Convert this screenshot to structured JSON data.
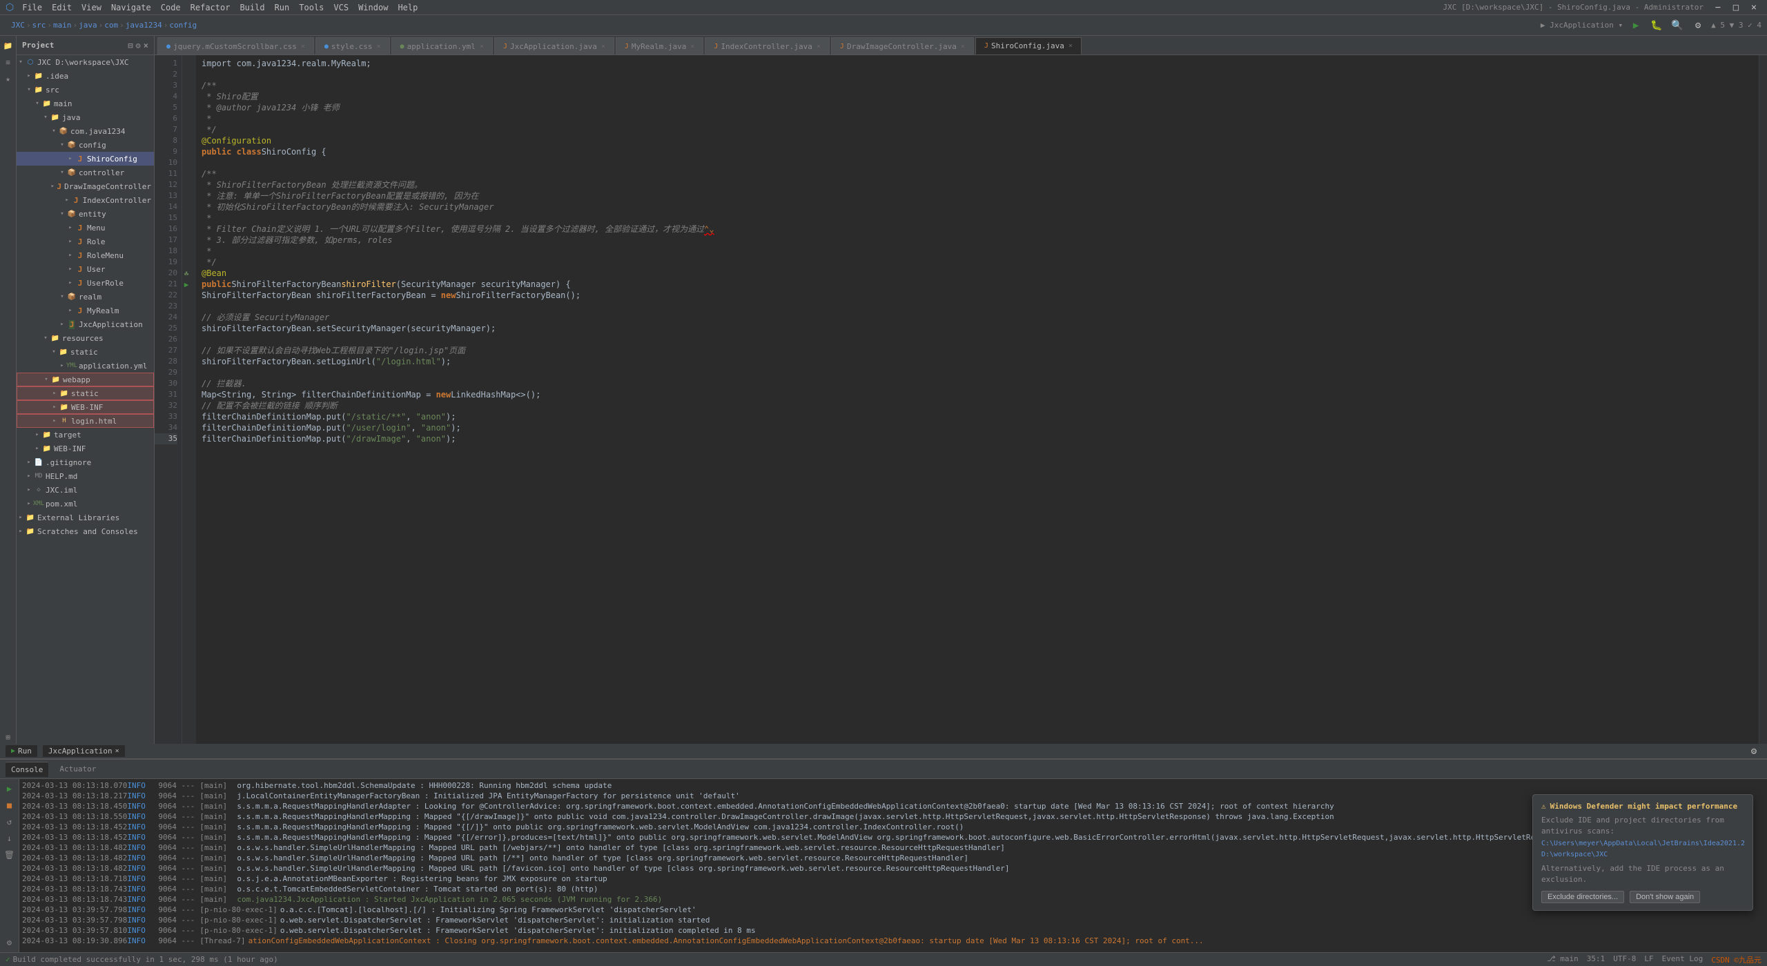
{
  "app": {
    "title": "JXC [D:\\workspace\\JXC] - ShiroConfig.java - Administrator",
    "window_title": "JXC [D:\\workspace\\JXC] - ShiroConfig.java - Administrator"
  },
  "menu": {
    "items": [
      "File",
      "Edit",
      "View",
      "Navigate",
      "Code",
      "Refactor",
      "Build",
      "Run",
      "Tools",
      "VCS",
      "Window",
      "Help"
    ]
  },
  "breadcrumb": {
    "items": [
      "JXC",
      "src",
      "main",
      "java",
      "com",
      "java1234",
      "config"
    ]
  },
  "tabs": [
    {
      "label": "jquery.mCustomScrollbar.css",
      "active": false
    },
    {
      "label": "style.css",
      "active": false
    },
    {
      "label": "application.yml",
      "active": false
    },
    {
      "label": "JxcApplication.java",
      "active": false
    },
    {
      "label": "MyRealm.java",
      "active": false
    },
    {
      "label": "IndexController.java",
      "active": false
    },
    {
      "label": "DrawImageController.java",
      "active": false
    },
    {
      "label": "ShiroConfig.java",
      "active": true
    }
  ],
  "project": {
    "header": "Project",
    "tree": [
      {
        "id": "jxc-root",
        "label": "JXC D:\\workspace\\JXC",
        "indent": 0,
        "icon": "project",
        "expanded": true,
        "selected": false
      },
      {
        "id": "idea",
        "label": ".idea",
        "indent": 1,
        "icon": "folder",
        "expanded": false,
        "selected": false
      },
      {
        "id": "src",
        "label": "src",
        "indent": 1,
        "icon": "folder",
        "expanded": true,
        "selected": false
      },
      {
        "id": "main",
        "label": "main",
        "indent": 2,
        "icon": "folder",
        "expanded": true,
        "selected": false
      },
      {
        "id": "java",
        "label": "java",
        "indent": 3,
        "icon": "folder-blue",
        "expanded": true,
        "selected": false
      },
      {
        "id": "com-java1234",
        "label": "com.java1234",
        "indent": 4,
        "icon": "package",
        "expanded": true,
        "selected": false
      },
      {
        "id": "config",
        "label": "config",
        "indent": 5,
        "icon": "package",
        "expanded": true,
        "selected": false
      },
      {
        "id": "shiroconfig",
        "label": "ShiroConfig",
        "indent": 6,
        "icon": "java",
        "expanded": false,
        "selected": true
      },
      {
        "id": "controller",
        "label": "controller",
        "indent": 5,
        "icon": "package",
        "expanded": true,
        "selected": false
      },
      {
        "id": "drawimagecontroller",
        "label": "DrawImageController",
        "indent": 6,
        "icon": "java",
        "expanded": false,
        "selected": false
      },
      {
        "id": "indexcontroller",
        "label": "IndexController",
        "indent": 6,
        "icon": "java",
        "expanded": false,
        "selected": false
      },
      {
        "id": "entity",
        "label": "entity",
        "indent": 5,
        "icon": "package",
        "expanded": true,
        "selected": false
      },
      {
        "id": "menu",
        "label": "Menu",
        "indent": 6,
        "icon": "java",
        "expanded": false,
        "selected": false
      },
      {
        "id": "role",
        "label": "Role",
        "indent": 6,
        "icon": "java",
        "expanded": false,
        "selected": false
      },
      {
        "id": "rolemenu",
        "label": "RoleMenu",
        "indent": 6,
        "icon": "java",
        "expanded": false,
        "selected": false
      },
      {
        "id": "user",
        "label": "User",
        "indent": 6,
        "icon": "java",
        "expanded": false,
        "selected": false
      },
      {
        "id": "userrole",
        "label": "UserRole",
        "indent": 6,
        "icon": "java",
        "expanded": false,
        "selected": false
      },
      {
        "id": "realm",
        "label": "realm",
        "indent": 5,
        "icon": "package",
        "expanded": true,
        "selected": false
      },
      {
        "id": "myrealm",
        "label": "MyRealm",
        "indent": 6,
        "icon": "java",
        "expanded": false,
        "selected": false
      },
      {
        "id": "jxcapplication",
        "label": "JxcApplication",
        "indent": 5,
        "icon": "java-main",
        "expanded": false,
        "selected": false
      },
      {
        "id": "resources",
        "label": "resources",
        "indent": 3,
        "icon": "folder",
        "expanded": true,
        "selected": false
      },
      {
        "id": "static",
        "label": "static",
        "indent": 4,
        "icon": "folder",
        "expanded": true,
        "selected": false
      },
      {
        "id": "application-yml",
        "label": "application.yml",
        "indent": 5,
        "icon": "yml",
        "expanded": false,
        "selected": false
      },
      {
        "id": "webapp",
        "label": "webapp",
        "indent": 3,
        "icon": "folder",
        "expanded": true,
        "selected": false,
        "highlighted": true
      },
      {
        "id": "static2",
        "label": "static",
        "indent": 4,
        "icon": "folder",
        "expanded": false,
        "selected": false,
        "highlighted": true
      },
      {
        "id": "web-inf",
        "label": "WEB-INF",
        "indent": 4,
        "icon": "folder",
        "expanded": false,
        "selected": false,
        "highlighted": true
      },
      {
        "id": "login-html",
        "label": "login.html",
        "indent": 4,
        "icon": "html",
        "expanded": false,
        "selected": false,
        "highlighted": true
      },
      {
        "id": "target",
        "label": "target",
        "indent": 2,
        "icon": "folder",
        "expanded": false,
        "selected": false
      },
      {
        "id": "web-inf2",
        "label": "WEB-INF",
        "indent": 2,
        "icon": "folder",
        "expanded": false,
        "selected": false
      },
      {
        "id": "gitignore",
        "label": ".gitignore",
        "indent": 1,
        "icon": "file",
        "expanded": false,
        "selected": false
      },
      {
        "id": "helpmd",
        "label": "HELP.md",
        "indent": 1,
        "icon": "md",
        "expanded": false,
        "selected": false
      },
      {
        "id": "jxcxml",
        "label": "JXC.iml",
        "indent": 1,
        "icon": "iml",
        "expanded": false,
        "selected": false
      },
      {
        "id": "pomxml",
        "label": "pom.xml",
        "indent": 1,
        "icon": "xml",
        "expanded": false,
        "selected": false
      },
      {
        "id": "external-libs",
        "label": "External Libraries",
        "indent": 0,
        "icon": "folder",
        "expanded": false,
        "selected": false
      },
      {
        "id": "scratches",
        "label": "Scratches and Consoles",
        "indent": 0,
        "icon": "folder",
        "expanded": false,
        "selected": false
      }
    ]
  },
  "editor": {
    "filename": "ShiroConfig.java",
    "lines": [
      {
        "num": 1,
        "content": "import com.java1234.realm.MyRealm;",
        "gutter": ""
      },
      {
        "num": 2,
        "content": "",
        "gutter": ""
      },
      {
        "num": 3,
        "content": "/**",
        "gutter": ""
      },
      {
        "num": 4,
        "content": " * Shiro配置",
        "gutter": ""
      },
      {
        "num": 5,
        "content": " * @author java1234 小锋 老师",
        "gutter": ""
      },
      {
        "num": 6,
        "content": " *",
        "gutter": ""
      },
      {
        "num": 7,
        "content": " */",
        "gutter": ""
      },
      {
        "num": 8,
        "content": "@Configuration",
        "gutter": ""
      },
      {
        "num": 9,
        "content": "public class ShiroConfig {",
        "gutter": ""
      },
      {
        "num": 10,
        "content": "",
        "gutter": ""
      },
      {
        "num": 11,
        "content": "    /**",
        "gutter": ""
      },
      {
        "num": 12,
        "content": "     * ShiroFilterFactoryBean 处理拦截资源文件问题。",
        "gutter": ""
      },
      {
        "num": 13,
        "content": "     * 注意: 单单一个ShiroFilterFactoryBean配置是或报错的, 因为在",
        "gutter": ""
      },
      {
        "num": 14,
        "content": "     * 初始化ShiroFilterFactoryBean的时候需要注入: SecurityManager",
        "gutter": ""
      },
      {
        "num": 15,
        "content": "     *",
        "gutter": ""
      },
      {
        "num": 16,
        "content": "     * Filter Chain定义说明 1. 一个URL可以配置多个Filter, 使用逗号分隔 2. 当设置多个过滤器时, 全部验证通过，才视为通过",
        "gutter": ""
      },
      {
        "num": 17,
        "content": "     * 3. 部分过滤器可指定参数, 如perms, roles",
        "gutter": ""
      },
      {
        "num": 18,
        "content": "     *",
        "gutter": ""
      },
      {
        "num": 19,
        "content": "     */",
        "gutter": ""
      },
      {
        "num": 20,
        "content": "    @Bean",
        "gutter": "bean"
      },
      {
        "num": 21,
        "content": "    public ShiroFilterFactoryBean shiroFilter(SecurityManager securityManager) {",
        "gutter": "run"
      },
      {
        "num": 22,
        "content": "        ShiroFilterFactoryBean shiroFilterFactoryBean = new ShiroFilterFactoryBean();",
        "gutter": ""
      },
      {
        "num": 23,
        "content": "",
        "gutter": ""
      },
      {
        "num": 24,
        "content": "        // 必须设置 SecurityManager",
        "gutter": ""
      },
      {
        "num": 25,
        "content": "        shiroFilterFactoryBean.setSecurityManager(securityManager);",
        "gutter": ""
      },
      {
        "num": 26,
        "content": "",
        "gutter": ""
      },
      {
        "num": 27,
        "content": "        // 如果不设置默认会自动寻找Web工程根目录下的\"/login.jsp\"页面",
        "gutter": ""
      },
      {
        "num": 28,
        "content": "        shiroFilterFactoryBean.setLoginUrl(\"/login.html\");",
        "gutter": ""
      },
      {
        "num": 29,
        "content": "",
        "gutter": ""
      },
      {
        "num": 30,
        "content": "        // 拦截器.",
        "gutter": ""
      },
      {
        "num": 31,
        "content": "        Map<String, String> filterChainDefinitionMap = new LinkedHashMap<>();",
        "gutter": ""
      },
      {
        "num": 32,
        "content": "        // 配置不会被拦截的链接 顺序判断",
        "gutter": ""
      },
      {
        "num": 33,
        "content": "        filterChainDefinitionMap.put(\"/static/**\", \"anon\");",
        "gutter": ""
      },
      {
        "num": 34,
        "content": "        filterChainDefinitionMap.put(\"/user/login\", \"anon\");",
        "gutter": ""
      },
      {
        "num": 35,
        "content": "        filterChainDefinitionMap.put(\"/drawImage\", \"anon\");",
        "gutter": ""
      }
    ]
  },
  "console": {
    "run_label": "Run",
    "app_label": "JxcApplication",
    "tabs": [
      "Console",
      "Actuator"
    ],
    "logs": [
      {
        "time": "2024-03-13 08:13:18.070",
        "level": "INFO",
        "pid": "9064",
        "dashes": "---",
        "thread": "[main]",
        "msg": "org.hibernate.tool.hbm2ddl.SchemaUpdate      : HHH000228: Running hbm2ddl schema update"
      },
      {
        "time": "2024-03-13 08:13:18.217",
        "level": "INFO",
        "pid": "9064",
        "dashes": "---",
        "thread": "[main]",
        "msg": "j.LocalContainerEntityManagerFactoryBean : Initialized JPA EntityManagerFactory for persistence unit 'default'"
      },
      {
        "time": "2024-03-13 08:13:18.450",
        "level": "INFO",
        "pid": "9064",
        "dashes": "---",
        "thread": "[main]",
        "msg": "s.s.m.m.a.RequestMappingHandlerAdapter : Looking for @ControllerAdvice: org.springframework.boot.context.embedded.AnnotationConfigEmbeddedWebApplicationContext@2b0faea0: startup date [Wed Mar 13 08:13:16 CST 2024]; root of context hierarchy"
      },
      {
        "time": "2024-03-13 08:13:18.550",
        "level": "INFO",
        "pid": "9064",
        "dashes": "---",
        "thread": "[main]",
        "msg": "s.s.m.m.a.RequestMappingHandlerMapping : Mapped \"{[/drawImage]}\" onto public void com.java1234.controller.DrawImageController.drawImage(javax.servlet.http.HttpServletRequest,javax.servlet.http.HttpServletResponse) throws java.lang.Exception"
      },
      {
        "time": "2024-03-13 08:13:18.452",
        "level": "INFO",
        "pid": "9064",
        "dashes": "---",
        "thread": "[main]",
        "msg": "s.s.m.m.a.RequestMappingHandlerMapping : Mapped \"{[/]}\" onto public org.springframework.web.servlet.ModelAndView com.java1234.controller.IndexController.root()"
      },
      {
        "time": "2024-03-13 08:13:18.452",
        "level": "INFO",
        "pid": "9064",
        "dashes": "---",
        "thread": "[main]",
        "msg": "s.s.m.m.a.RequestMappingHandlerMapping : Mapped \"{[/error]},produces=[text/html]}\" onto public org.springframework.web.servlet.ModelAndView org.springframework.boot.autoconfigure.web.BasicErrorController.errorHtml(javax.servlet.http.HttpServletRequest,javax.servlet.http.HttpServletResponse)"
      },
      {
        "time": "2024-03-13 08:13:18.482",
        "level": "INFO",
        "pid": "9064",
        "dashes": "---",
        "thread": "[main]",
        "msg": "o.s.w.s.handler.SimpleUrlHandlerMapping : Mapped URL path [/webjars/**] onto handler of type [class org.springframework.web.servlet.resource.ResourceHttpRequestHandler]"
      },
      {
        "time": "2024-03-13 08:13:18.482",
        "level": "INFO",
        "pid": "9064",
        "dashes": "---",
        "thread": "[main]",
        "msg": "o.s.w.s.handler.SimpleUrlHandlerMapping : Mapped URL path [/**] onto handler of type [class org.springframework.web.servlet.resource.ResourceHttpRequestHandler]"
      },
      {
        "time": "2024-03-13 08:13:18.482",
        "level": "INFO",
        "pid": "9064",
        "dashes": "---",
        "thread": "[main]",
        "msg": "o.s.w.s.handler.SimpleUrlHandlerMapping : Mapped URL path [/favicon.ico] onto handler of type [class org.springframework.web.servlet.resource.ResourceHttpRequestHandler]"
      },
      {
        "time": "2024-03-13 08:13:18.718",
        "level": "INFO",
        "pid": "9064",
        "dashes": "---",
        "thread": "[main]",
        "msg": "o.s.j.e.a.AnnotationMBeanExporter       : Registering beans for JMX exposure on startup"
      },
      {
        "time": "2024-03-13 08:13:18.743",
        "level": "INFO",
        "pid": "9064",
        "dashes": "---",
        "thread": "[main]",
        "msg": "o.s.c.e.t.TomcatEmbeddedServletContainer : Tomcat started on port(s): 80 (http)"
      },
      {
        "time": "2024-03-13 08:13:18.743",
        "level": "INFO",
        "pid": "9064",
        "dashes": "---",
        "thread": "[main]",
        "msg": "com.java1234.JxcApplication              : Started JxcApplication in 2.065 seconds (JVM running for 2.366)"
      },
      {
        "time": "2024-03-13 03:39:57.798",
        "level": "INFO",
        "pid": "9064",
        "dashes": "---",
        "thread": "[p-nio-80-exec-1]",
        "msg": "o.a.c.c.[Tomcat].[localhost].[/]         : Initializing Spring FrameworkServlet 'dispatcherServlet'"
      },
      {
        "time": "2024-03-13 03:39:57.798",
        "level": "INFO",
        "pid": "9064",
        "dashes": "---",
        "thread": "[p-nio-80-exec-1]",
        "msg": "o.web.servlet.DispatcherServlet          : FrameworkServlet 'dispatcherServlet': initialization started"
      },
      {
        "time": "2024-03-13 03:39:57.810",
        "level": "INFO",
        "pid": "9064",
        "dashes": "---",
        "thread": "[p-nio-80-exec-1]",
        "msg": "o.web.servlet.DispatcherServlet          : FrameworkServlet 'dispatcherServlet': initialization completed in 8 ms"
      },
      {
        "time": "2024-03-13 08:19:30.896",
        "level": "INFO",
        "pid": "9064",
        "dashes": "---",
        "thread": "[Thread-7]",
        "msg": "ationConfigEmbeddedWebApplicationContext : Closing org.springframework.boot.context.embedded.AnnotationConfigEmbeddedWebApplicationContext@2b0faeao: startup date [Wed Mar 13 08:13:16 CST 2024]; root of cont..."
      }
    ]
  },
  "status_bar": {
    "build_status": "Build completed successfully in 1 sec, 298 ms (1 hour ago)",
    "event_log": "Event Log",
    "position": "35:1",
    "encoding": "UTF-8",
    "line_separator": "LF",
    "column": "Git: main",
    "warnings": "▲ 5 ▼ 3 ✓ 4"
  },
  "notification": {
    "title": "Windows Defender might impact performance",
    "body": "Exclude IDE and project directories from antivirus scans:",
    "path1": "C:\\Users\\meyer\\AppData\\Local\\JetBrains\\Idea2021.2",
    "path2": "D:\\workspace\\JXC",
    "footer": "Alternatively, add the IDE process as an exclusion.",
    "action1": "Exclude directories...",
    "action2": "Don't show again"
  }
}
